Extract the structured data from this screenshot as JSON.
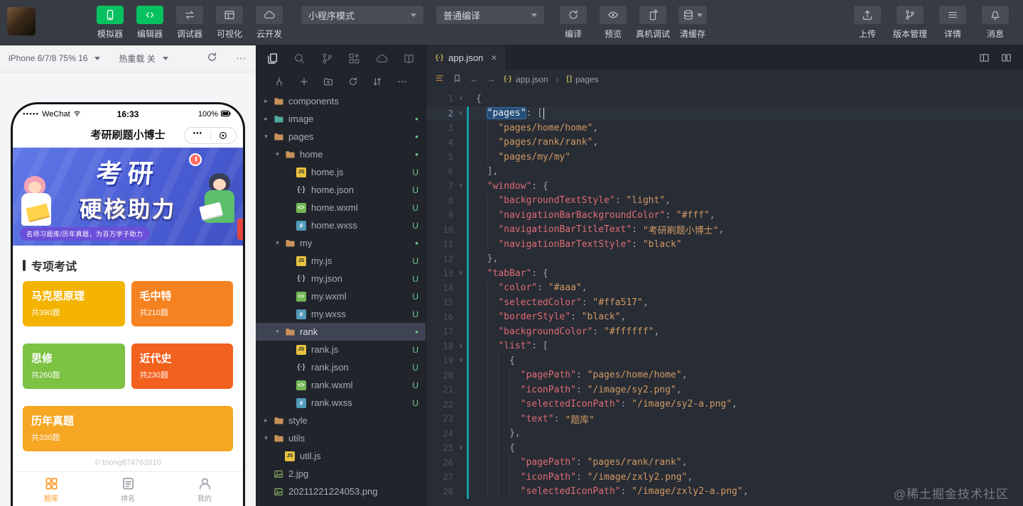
{
  "glyphs": {
    "more": "⋯",
    "close": "×",
    "chevron_right": "▸",
    "chevron_down": "▾",
    "fold": "∨",
    "dot": "●",
    "sep": "›",
    "back": "←",
    "forward": "→",
    "json_icon": "{·}",
    "array_icon": "[ ]",
    "js_label": "JS",
    "wxml_label": "<>",
    "wxss_label": "#",
    "signal_dots": "●●●●●"
  },
  "colors": {
    "accent_green": "#07c160",
    "git_badge": "#73c991",
    "git_gutter": "#149ba5",
    "tab_selected_orange": "#ff9b28"
  },
  "toolbar": {
    "mode_buttons": [
      {
        "label": "模拟器",
        "icon": "simulator-icon",
        "active": true
      },
      {
        "label": "编辑器",
        "icon": "editor-icon",
        "active": true
      },
      {
        "label": "调试器",
        "icon": "debugger-icon",
        "active": false
      },
      {
        "label": "可视化",
        "icon": "visual-icon",
        "active": false
      },
      {
        "label": "云开发",
        "icon": "cloud-dev-icon",
        "active": false
      }
    ],
    "mode_select": "小程序模式",
    "compile_select": "普通编译",
    "action_buttons": [
      {
        "label": "编译",
        "icon": "compile-icon",
        "caret": false
      },
      {
        "label": "预览",
        "icon": "preview-icon",
        "caret": false
      },
      {
        "label": "真机调试",
        "icon": "device-debug-icon",
        "caret": false
      },
      {
        "label": "清缓存",
        "icon": "clear-cache-icon",
        "caret": true
      }
    ],
    "right_buttons": [
      {
        "label": "上传",
        "icon": "upload-icon"
      },
      {
        "label": "版本管理",
        "icon": "version-icon"
      },
      {
        "label": "详情",
        "icon": "details-icon"
      },
      {
        "label": "消息",
        "icon": "bell-icon"
      }
    ]
  },
  "simulator": {
    "device_label": "iPhone 6/7/8 75% 16",
    "hot_reload_label": "热重载 关",
    "phone": {
      "status": {
        "carrier": "WeChat",
        "time": "16:33",
        "battery": "100%"
      },
      "nav_title": "考研刷题小博士",
      "banner": {
        "title": "考研",
        "subtitle": "硬核助力",
        "tagline": "名师习题库/历年真题，为百万学子助力"
      },
      "section_title": "专项考试",
      "cards": [
        {
          "title": "马克思原理",
          "count": "共390题",
          "color": "#f3b300",
          "span": 1
        },
        {
          "title": "毛中特",
          "count": "共210题",
          "color": "#f58220",
          "span": 1
        },
        {
          "title": "思修",
          "count": "共260题",
          "color": "#7cc243",
          "span": 1
        },
        {
          "title": "近代史",
          "count": "共230题",
          "color": "#f2611d",
          "span": 1
        },
        {
          "title": "历年真题",
          "count": "共330题",
          "color": "#f5a623",
          "span": 2
        }
      ],
      "watermark": "© tnong874762010",
      "tabbar": [
        {
          "label": "题库",
          "icon": "grid-icon",
          "active": true
        },
        {
          "label": "排名",
          "icon": "rank-icon",
          "active": false
        },
        {
          "label": "我的",
          "icon": "profile-icon",
          "active": false
        }
      ]
    }
  },
  "explorer": {
    "top_icons": [
      "files-icon",
      "search-icon",
      "git-branch-icon",
      "extensions-icon",
      "cloud-icon",
      "docs-icon"
    ],
    "action_icons": [
      "fork-icon",
      "new-file-icon",
      "new-folder-icon",
      "refresh-icon",
      "sort-icon",
      "more-icon"
    ],
    "tree": [
      {
        "name": "components",
        "kind": "folder",
        "depth": 0,
        "expanded": false
      },
      {
        "name": "image",
        "kind": "folder",
        "depth": 0,
        "expanded": false,
        "dot": true,
        "tint": "teal"
      },
      {
        "name": "pages",
        "kind": "folder",
        "depth": 0,
        "expanded": true,
        "dot": true
      },
      {
        "name": "home",
        "kind": "folder",
        "depth": 1,
        "expanded": true,
        "dot": true
      },
      {
        "name": "home.js",
        "kind": "js",
        "depth": 2,
        "badge": "U"
      },
      {
        "name": "home.json",
        "kind": "json",
        "depth": 2,
        "badge": "U"
      },
      {
        "name": "home.wxml",
        "kind": "wxml",
        "depth": 2,
        "badge": "U"
      },
      {
        "name": "home.wxss",
        "kind": "wxss",
        "depth": 2,
        "badge": "U"
      },
      {
        "name": "my",
        "kind": "folder",
        "depth": 1,
        "expanded": true,
        "dot": true
      },
      {
        "name": "my.js",
        "kind": "js",
        "depth": 2,
        "badge": "U"
      },
      {
        "name": "my.json",
        "kind": "json",
        "depth": 2,
        "badge": "U"
      },
      {
        "name": "my.wxml",
        "kind": "wxml",
        "depth": 2,
        "badge": "U"
      },
      {
        "name": "my.wxss",
        "kind": "wxss",
        "depth": 2,
        "badge": "U"
      },
      {
        "name": "rank",
        "kind": "folder",
        "depth": 1,
        "expanded": true,
        "dot": true,
        "selected": true
      },
      {
        "name": "rank.js",
        "kind": "js",
        "depth": 2,
        "badge": "U"
      },
      {
        "name": "rank.json",
        "kind": "json",
        "depth": 2,
        "badge": "U"
      },
      {
        "name": "rank.wxml",
        "kind": "wxml",
        "depth": 2,
        "badge": "U"
      },
      {
        "name": "rank.wxss",
        "kind": "wxss",
        "depth": 2,
        "badge": "U"
      },
      {
        "name": "style",
        "kind": "folder",
        "depth": 0,
        "expanded": false
      },
      {
        "name": "utils",
        "kind": "folder",
        "depth": 0,
        "expanded": true
      },
      {
        "name": "util.js",
        "kind": "js",
        "depth": 1
      },
      {
        "name": "2.jpg",
        "kind": "img",
        "depth": 0
      },
      {
        "name": "20211221224053.png",
        "kind": "img",
        "depth": 0
      }
    ]
  },
  "editor": {
    "tab": {
      "name": "app.json"
    },
    "breadcrumb": {
      "file": "app.json",
      "node": "pages"
    },
    "code": {
      "lines": [
        {
          "n": 1,
          "ind": 0,
          "fold": true,
          "t": [
            [
              "p",
              "{"
            ]
          ]
        },
        {
          "n": 2,
          "ind": 2,
          "fold": true,
          "cur": true,
          "gut": true,
          "t": [
            [
              "p",
              "  "
            ],
            [
              "ks",
              "\"pages\""
            ],
            [
              "p",
              ": ["
            ],
            [
              "caret",
              ""
            ]
          ]
        },
        {
          "n": 3,
          "ind": 4,
          "gut": true,
          "t": [
            [
              "p",
              "    "
            ],
            [
              "v",
              "\"pages/home/home\""
            ],
            [
              "p",
              ","
            ]
          ]
        },
        {
          "n": 4,
          "ind": 4,
          "gut": true,
          "t": [
            [
              "p",
              "    "
            ],
            [
              "v",
              "\"pages/rank/rank\""
            ],
            [
              "p",
              ","
            ]
          ]
        },
        {
          "n": 5,
          "ind": 4,
          "gut": true,
          "t": [
            [
              "p",
              "    "
            ],
            [
              "v",
              "\"pages/my/my\""
            ]
          ]
        },
        {
          "n": 6,
          "ind": 2,
          "gut": true,
          "t": [
            [
              "p",
              "  ],"
            ]
          ]
        },
        {
          "n": 7,
          "ind": 2,
          "fold": true,
          "gut": true,
          "t": [
            [
              "p",
              "  "
            ],
            [
              "k",
              "\"window\""
            ],
            [
              "p",
              ": {"
            ]
          ]
        },
        {
          "n": 8,
          "ind": 4,
          "gut": true,
          "t": [
            [
              "p",
              "    "
            ],
            [
              "k",
              "\"backgroundTextStyle\""
            ],
            [
              "p",
              ": "
            ],
            [
              "v",
              "\"light\""
            ],
            [
              "p",
              ","
            ]
          ]
        },
        {
          "n": 9,
          "ind": 4,
          "gut": true,
          "t": [
            [
              "p",
              "    "
            ],
            [
              "k",
              "\"navigationBarBackgroundColor\""
            ],
            [
              "p",
              ": "
            ],
            [
              "v",
              "\"#fff\""
            ],
            [
              "p",
              ","
            ]
          ]
        },
        {
          "n": 10,
          "ind": 4,
          "gut": true,
          "t": [
            [
              "p",
              "    "
            ],
            [
              "k",
              "\"navigationBarTitleText\""
            ],
            [
              "p",
              ": "
            ],
            [
              "v",
              "\"考研刷题小博士\""
            ],
            [
              "p",
              ","
            ]
          ]
        },
        {
          "n": 11,
          "ind": 4,
          "gut": true,
          "t": [
            [
              "p",
              "    "
            ],
            [
              "k",
              "\"navigationBarTextStyle\""
            ],
            [
              "p",
              ": "
            ],
            [
              "v",
              "\"black\""
            ]
          ]
        },
        {
          "n": 12,
          "ind": 2,
          "gut": true,
          "t": [
            [
              "p",
              "  },"
            ]
          ]
        },
        {
          "n": 13,
          "ind": 2,
          "fold": true,
          "gut": true,
          "t": [
            [
              "p",
              "  "
            ],
            [
              "k",
              "\"tabBar\""
            ],
            [
              "p",
              ": {"
            ]
          ]
        },
        {
          "n": 14,
          "ind": 4,
          "gut": true,
          "t": [
            [
              "p",
              "    "
            ],
            [
              "k",
              "\"color\""
            ],
            [
              "p",
              ": "
            ],
            [
              "v",
              "\"#aaa\""
            ],
            [
              "p",
              ","
            ]
          ]
        },
        {
          "n": 15,
          "ind": 4,
          "gut": true,
          "t": [
            [
              "p",
              "    "
            ],
            [
              "k",
              "\"selectedColor\""
            ],
            [
              "p",
              ": "
            ],
            [
              "v",
              "\"#ffa517\""
            ],
            [
              "p",
              ","
            ]
          ]
        },
        {
          "n": 16,
          "ind": 4,
          "gut": true,
          "t": [
            [
              "p",
              "    "
            ],
            [
              "k",
              "\"borderStyle\""
            ],
            [
              "p",
              ": "
            ],
            [
              "v",
              "\"black\""
            ],
            [
              "p",
              ","
            ]
          ]
        },
        {
          "n": 17,
          "ind": 4,
          "gut": true,
          "t": [
            [
              "p",
              "    "
            ],
            [
              "k",
              "\"backgroundColor\""
            ],
            [
              "p",
              ": "
            ],
            [
              "v",
              "\"#ffffff\""
            ],
            [
              "p",
              ","
            ]
          ]
        },
        {
          "n": 18,
          "ind": 4,
          "fold": true,
          "gut": true,
          "t": [
            [
              "p",
              "    "
            ],
            [
              "k",
              "\"list\""
            ],
            [
              "p",
              ": ["
            ]
          ]
        },
        {
          "n": 19,
          "ind": 6,
          "fold": true,
          "gut": true,
          "t": [
            [
              "p",
              "      {"
            ]
          ]
        },
        {
          "n": 20,
          "ind": 8,
          "gut": true,
          "t": [
            [
              "p",
              "        "
            ],
            [
              "k",
              "\"pagePath\""
            ],
            [
              "p",
              ": "
            ],
            [
              "v",
              "\"pages/home/home\""
            ],
            [
              "p",
              ","
            ]
          ]
        },
        {
          "n": 21,
          "ind": 8,
          "gut": true,
          "t": [
            [
              "p",
              "        "
            ],
            [
              "k",
              "\"iconPath\""
            ],
            [
              "p",
              ": "
            ],
            [
              "v",
              "\"/image/sy2.png\""
            ],
            [
              "p",
              ","
            ]
          ]
        },
        {
          "n": 22,
          "ind": 8,
          "gut": true,
          "t": [
            [
              "p",
              "        "
            ],
            [
              "k",
              "\"selectedIconPath\""
            ],
            [
              "p",
              ": "
            ],
            [
              "v",
              "\"/image/sy2-a.png\""
            ],
            [
              "p",
              ","
            ]
          ]
        },
        {
          "n": 23,
          "ind": 8,
          "gut": true,
          "t": [
            [
              "p",
              "        "
            ],
            [
              "k",
              "\"text\""
            ],
            [
              "p",
              ": "
            ],
            [
              "v",
              "\"题库\""
            ]
          ]
        },
        {
          "n": 24,
          "ind": 6,
          "gut": true,
          "t": [
            [
              "p",
              "      },"
            ]
          ]
        },
        {
          "n": 25,
          "ind": 6,
          "fold": true,
          "gut": true,
          "t": [
            [
              "p",
              "      {"
            ]
          ]
        },
        {
          "n": 26,
          "ind": 8,
          "gut": true,
          "t": [
            [
              "p",
              "        "
            ],
            [
              "k",
              "\"pagePath\""
            ],
            [
              "p",
              ": "
            ],
            [
              "v",
              "\"pages/rank/rank\""
            ],
            [
              "p",
              ","
            ]
          ]
        },
        {
          "n": 27,
          "ind": 8,
          "gut": true,
          "t": [
            [
              "p",
              "        "
            ],
            [
              "k",
              "\"iconPath\""
            ],
            [
              "p",
              ": "
            ],
            [
              "v",
              "\"/image/zxly2.png\""
            ],
            [
              "p",
              ","
            ]
          ]
        },
        {
          "n": 28,
          "ind": 8,
          "gut": true,
          "t": [
            [
              "p",
              "        "
            ],
            [
              "k",
              "\"selectedIconPath\""
            ],
            [
              "p",
              ": "
            ],
            [
              "v",
              "\"/image/zxly2-a.png\""
            ],
            [
              "p",
              ","
            ]
          ]
        }
      ]
    }
  },
  "page_watermark": "@稀土掘金技术社区"
}
